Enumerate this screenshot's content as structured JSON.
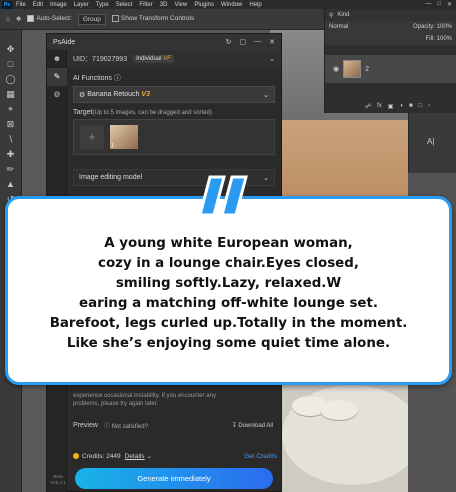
{
  "menubar": {
    "items": [
      "File",
      "Edit",
      "Image",
      "Layer",
      "Type",
      "Select",
      "Filter",
      "3D",
      "View",
      "Plugins",
      "Window",
      "Help"
    ],
    "logo": "Ps"
  },
  "options_bar": {
    "auto_select_label": "Auto-Select:",
    "group_value": "Group",
    "transform_label": "Show Transform Controls"
  },
  "layers_panel": {
    "search_label": "Kind",
    "blend_mode": "Normal",
    "opacity_label": "Opacity:",
    "opacity_value": "100%",
    "fill_label": "Fill:",
    "fill_value": "100%",
    "layer_name": "2"
  },
  "plugin": {
    "title": "PsAide",
    "uid_label": "UID：719027993",
    "account_type": "Individual",
    "account_tag": "VF",
    "ai_functions_label": "AI Functions",
    "function_value": "Banana Retouch",
    "function_version": "V3",
    "target_label": "Target",
    "target_hint": "(Up to 5 images, can be dragged and sorted)",
    "target_index": "1",
    "model_label": "Image editing model",
    "info_text_1": "experience occasional instability. If you encounter any",
    "info_text_2": "problems, please try again later.",
    "preview_label": "Preview",
    "not_satisfied": "Not satisfied?",
    "download_all": "Download All",
    "credits_label": "Credits: 2449",
    "details_label": "Details",
    "get_credits": "Get Credits",
    "generate_button": "Generate immediately",
    "beta_label": "Beta V25.4.1"
  },
  "overlay": {
    "line1": "A young white European woman,",
    "line2": "cozy in a lounge chair.Eyes closed,",
    "line3": "smiling softly.Lazy, relaxed.W",
    "line4": "earing a matching off-white lounge set.",
    "line5": "Barefoot, legs curled up.Totally in the moment.",
    "line6": "Like she’s enjoying some quiet time alone."
  },
  "colors": {
    "accent_blue": "#2a9bf2",
    "quote_mark": "#2a9bf2",
    "button_gradient_start": "#18b4e8",
    "button_gradient_end": "#2b6cf0",
    "version_orange": "#f0a640"
  }
}
